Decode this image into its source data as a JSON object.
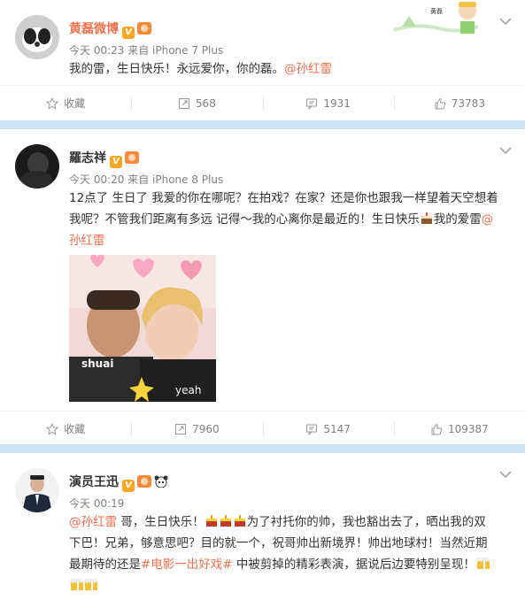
{
  "posts": [
    {
      "username": "黄磊微博",
      "time": "今天 00:23 来自 iPhone 7 Plus",
      "text_a": "我的雷，生日快乐！永远爱你，你的磊。",
      "mention": "@孙红雷",
      "actions": {
        "fav": "收藏",
        "repost": "568",
        "comment": "1931",
        "like": "73783"
      },
      "banner_text": "黄磊"
    },
    {
      "username": "羅志祥",
      "time": "今天 00:20 来自 iPhone 8 Plus",
      "line1": "12点了 生日了 我爱的你在哪呢？在拍戏？在家？还是你也跟我一样望着天空想着",
      "line2_a": "我呢？不管我们距离有多远 记得～我的心离你是最近的！生日快乐",
      "line2_b": "我的爱雷",
      "line2_mention": "@",
      "line3_mention": "孙红雷",
      "photo_caption": "shuai",
      "photo_text2": "yeah",
      "actions": {
        "fav": "收藏",
        "repost": "7960",
        "comment": "5147",
        "like": "109387"
      }
    },
    {
      "username": "演员王迅",
      "time": "今天 00:19",
      "l1_mention": "@孙红雷",
      "l1_a": " 哥，生日快乐！",
      "l1_b": "为了衬托你的帅，我也豁出去了，晒出我的双",
      "l2": "下巴！兄弟，够意思吧？目的就一个，祝哥帅出新境界！帅出地球村！当然近期",
      "l3_a": "最期待的还是",
      "l3_tag": "#电影一出好戏#",
      "l3_b": " 中被剪掉的精彩表演，据说后边要特别呈现！"
    }
  ],
  "colors": {
    "accent": "#eb7350",
    "separator": "#c9e3f3",
    "meta": "#808080"
  }
}
